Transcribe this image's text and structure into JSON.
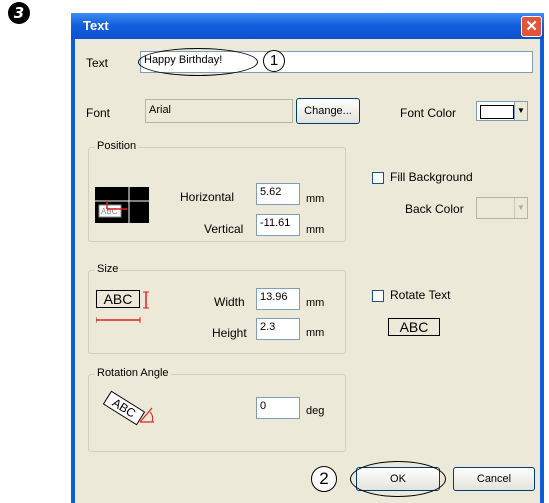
{
  "step": "3",
  "dialog": {
    "title": "Text",
    "close_glyph": "✕",
    "text_label": "Text",
    "text_value": "Happy Birthday!",
    "callout_1": "1",
    "font_label": "Font",
    "font_value": "Arial",
    "change_button": "Change...",
    "font_color_label": "Font Color",
    "font_color_value": "#ffffff",
    "position": {
      "group_label": "Position",
      "horizontal_label": "Horizontal",
      "horizontal_value": "5.62",
      "vertical_label": "Vertical",
      "vertical_value": "-11.61",
      "unit": "mm"
    },
    "fill_background_label": "Fill Background",
    "back_color_label": "Back Color",
    "size": {
      "group_label": "Size",
      "width_label": "Width",
      "width_value": "13.96",
      "height_label": "Height",
      "height_value": "2.3",
      "unit": "mm"
    },
    "rotate_text_label": "Rotate Text",
    "abc_sample": "ABC",
    "rotation": {
      "group_label": "Rotation Angle",
      "value": "0",
      "unit": "deg"
    },
    "callout_2": "2",
    "ok_button": "OK",
    "cancel_button": "Cancel"
  },
  "colors": {
    "title_bar": "#1560de",
    "client": "#ece9d8",
    "close": "#e2553a"
  }
}
